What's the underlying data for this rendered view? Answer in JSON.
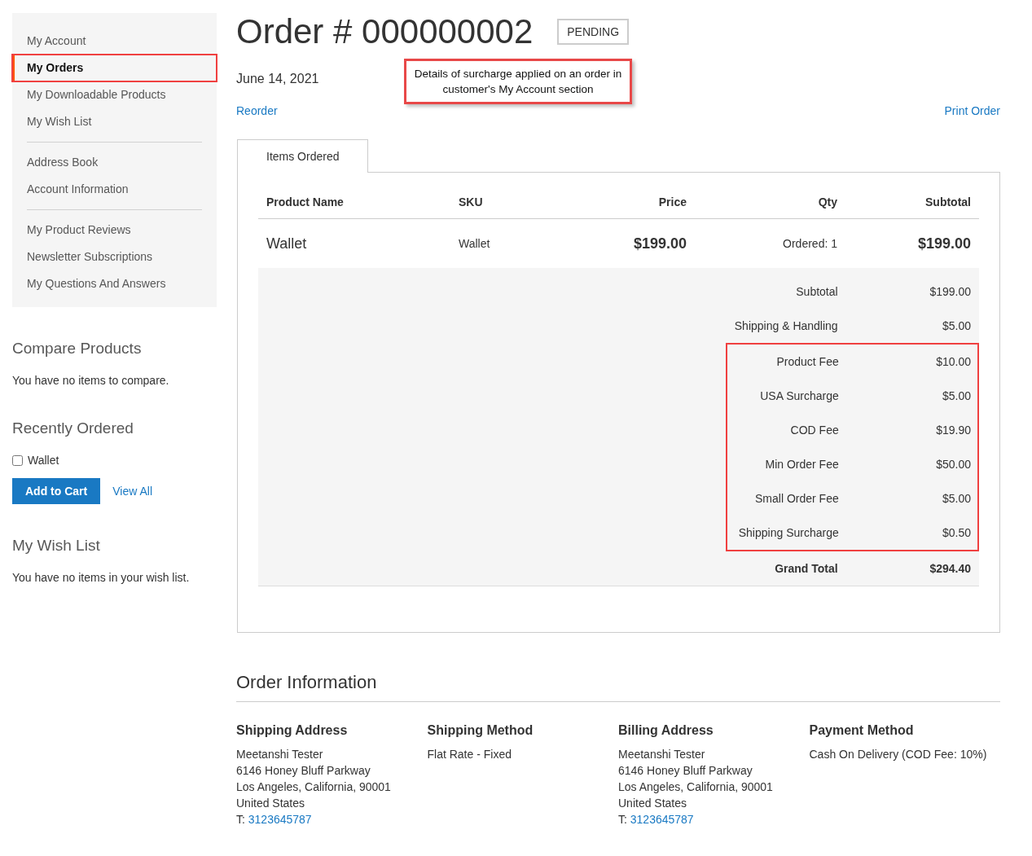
{
  "sidebar": {
    "groups": [
      [
        {
          "label": "My Account",
          "selected": false,
          "highlighted": false
        },
        {
          "label": "My Orders",
          "selected": true,
          "highlighted": true
        },
        {
          "label": "My Downloadable Products",
          "selected": false,
          "highlighted": false
        },
        {
          "label": "My Wish List",
          "selected": false,
          "highlighted": false
        }
      ],
      [
        {
          "label": "Address Book",
          "selected": false,
          "highlighted": false
        },
        {
          "label": "Account Information",
          "selected": false,
          "highlighted": false
        }
      ],
      [
        {
          "label": "My Product Reviews",
          "selected": false,
          "highlighted": false
        },
        {
          "label": "Newsletter Subscriptions",
          "selected": false,
          "highlighted": false
        },
        {
          "label": "My Questions And Answers",
          "selected": false,
          "highlighted": false
        }
      ]
    ]
  },
  "compare": {
    "title": "Compare Products",
    "message": "You have no items to compare."
  },
  "recently_ordered": {
    "title": "Recently Ordered",
    "items": [
      {
        "label": "Wallet",
        "checked": false
      }
    ],
    "add_button": "Add to Cart",
    "view_all": "View All"
  },
  "wish_list": {
    "title": "My Wish List",
    "message": "You have no items in your wish list."
  },
  "order": {
    "title": "Order # 000000002",
    "status": "PENDING",
    "date": "June 14, 2021",
    "reorder": "Reorder",
    "print": "Print Order",
    "annotation": "Details of surcharge applied on an order in customer's My Account section"
  },
  "tabs": [
    {
      "label": "Items Ordered",
      "selected": true
    }
  ],
  "table": {
    "columns": [
      "Product Name",
      "SKU",
      "Price",
      "Qty",
      "Subtotal"
    ],
    "rows": [
      {
        "name": "Wallet",
        "sku": "Wallet",
        "price": "$199.00",
        "qty": "Ordered: 1",
        "subtotal": "$199.00"
      }
    ]
  },
  "totals": [
    {
      "kind": "normal",
      "label": "Subtotal",
      "value": "$199.00",
      "highlighted": false
    },
    {
      "kind": "normal",
      "label": "Shipping & Handling",
      "value": "$5.00",
      "highlighted": false
    },
    {
      "kind": "normal",
      "label": "Product Fee",
      "value": "$10.00",
      "highlighted": true
    },
    {
      "kind": "normal",
      "label": "USA Surcharge",
      "value": "$5.00",
      "highlighted": true
    },
    {
      "kind": "normal",
      "label": "COD Fee",
      "value": "$19.90",
      "highlighted": true
    },
    {
      "kind": "normal",
      "label": "Min Order Fee",
      "value": "$50.00",
      "highlighted": true
    },
    {
      "kind": "normal",
      "label": "Small Order Fee",
      "value": "$5.00",
      "highlighted": true
    },
    {
      "kind": "normal",
      "label": "Shipping Surcharge",
      "value": "$0.50",
      "highlighted": true
    },
    {
      "kind": "grand",
      "label": "Grand Total",
      "value": "$294.40",
      "highlighted": false
    }
  ],
  "order_information": {
    "title": "Order Information",
    "sections": [
      {
        "title": "Shipping Address",
        "lines": [
          "Meetanshi Tester",
          "6146 Honey Bluff Parkway",
          "Los Angeles, California, 90001",
          "United States"
        ],
        "phone": {
          "prefix": "T:",
          "number": "3123645787"
        }
      },
      {
        "title": "Shipping Method",
        "lines": [
          "Flat Rate - Fixed"
        ]
      },
      {
        "title": "Billing Address",
        "lines": [
          "Meetanshi Tester",
          "6146 Honey Bluff Parkway",
          "Los Angeles, California, 90001",
          "United States"
        ],
        "phone": {
          "prefix": "T:",
          "number": "3123645787"
        }
      },
      {
        "title": "Payment Method",
        "lines": [
          "Cash On Delivery (COD Fee: 10%)"
        ]
      }
    ]
  }
}
